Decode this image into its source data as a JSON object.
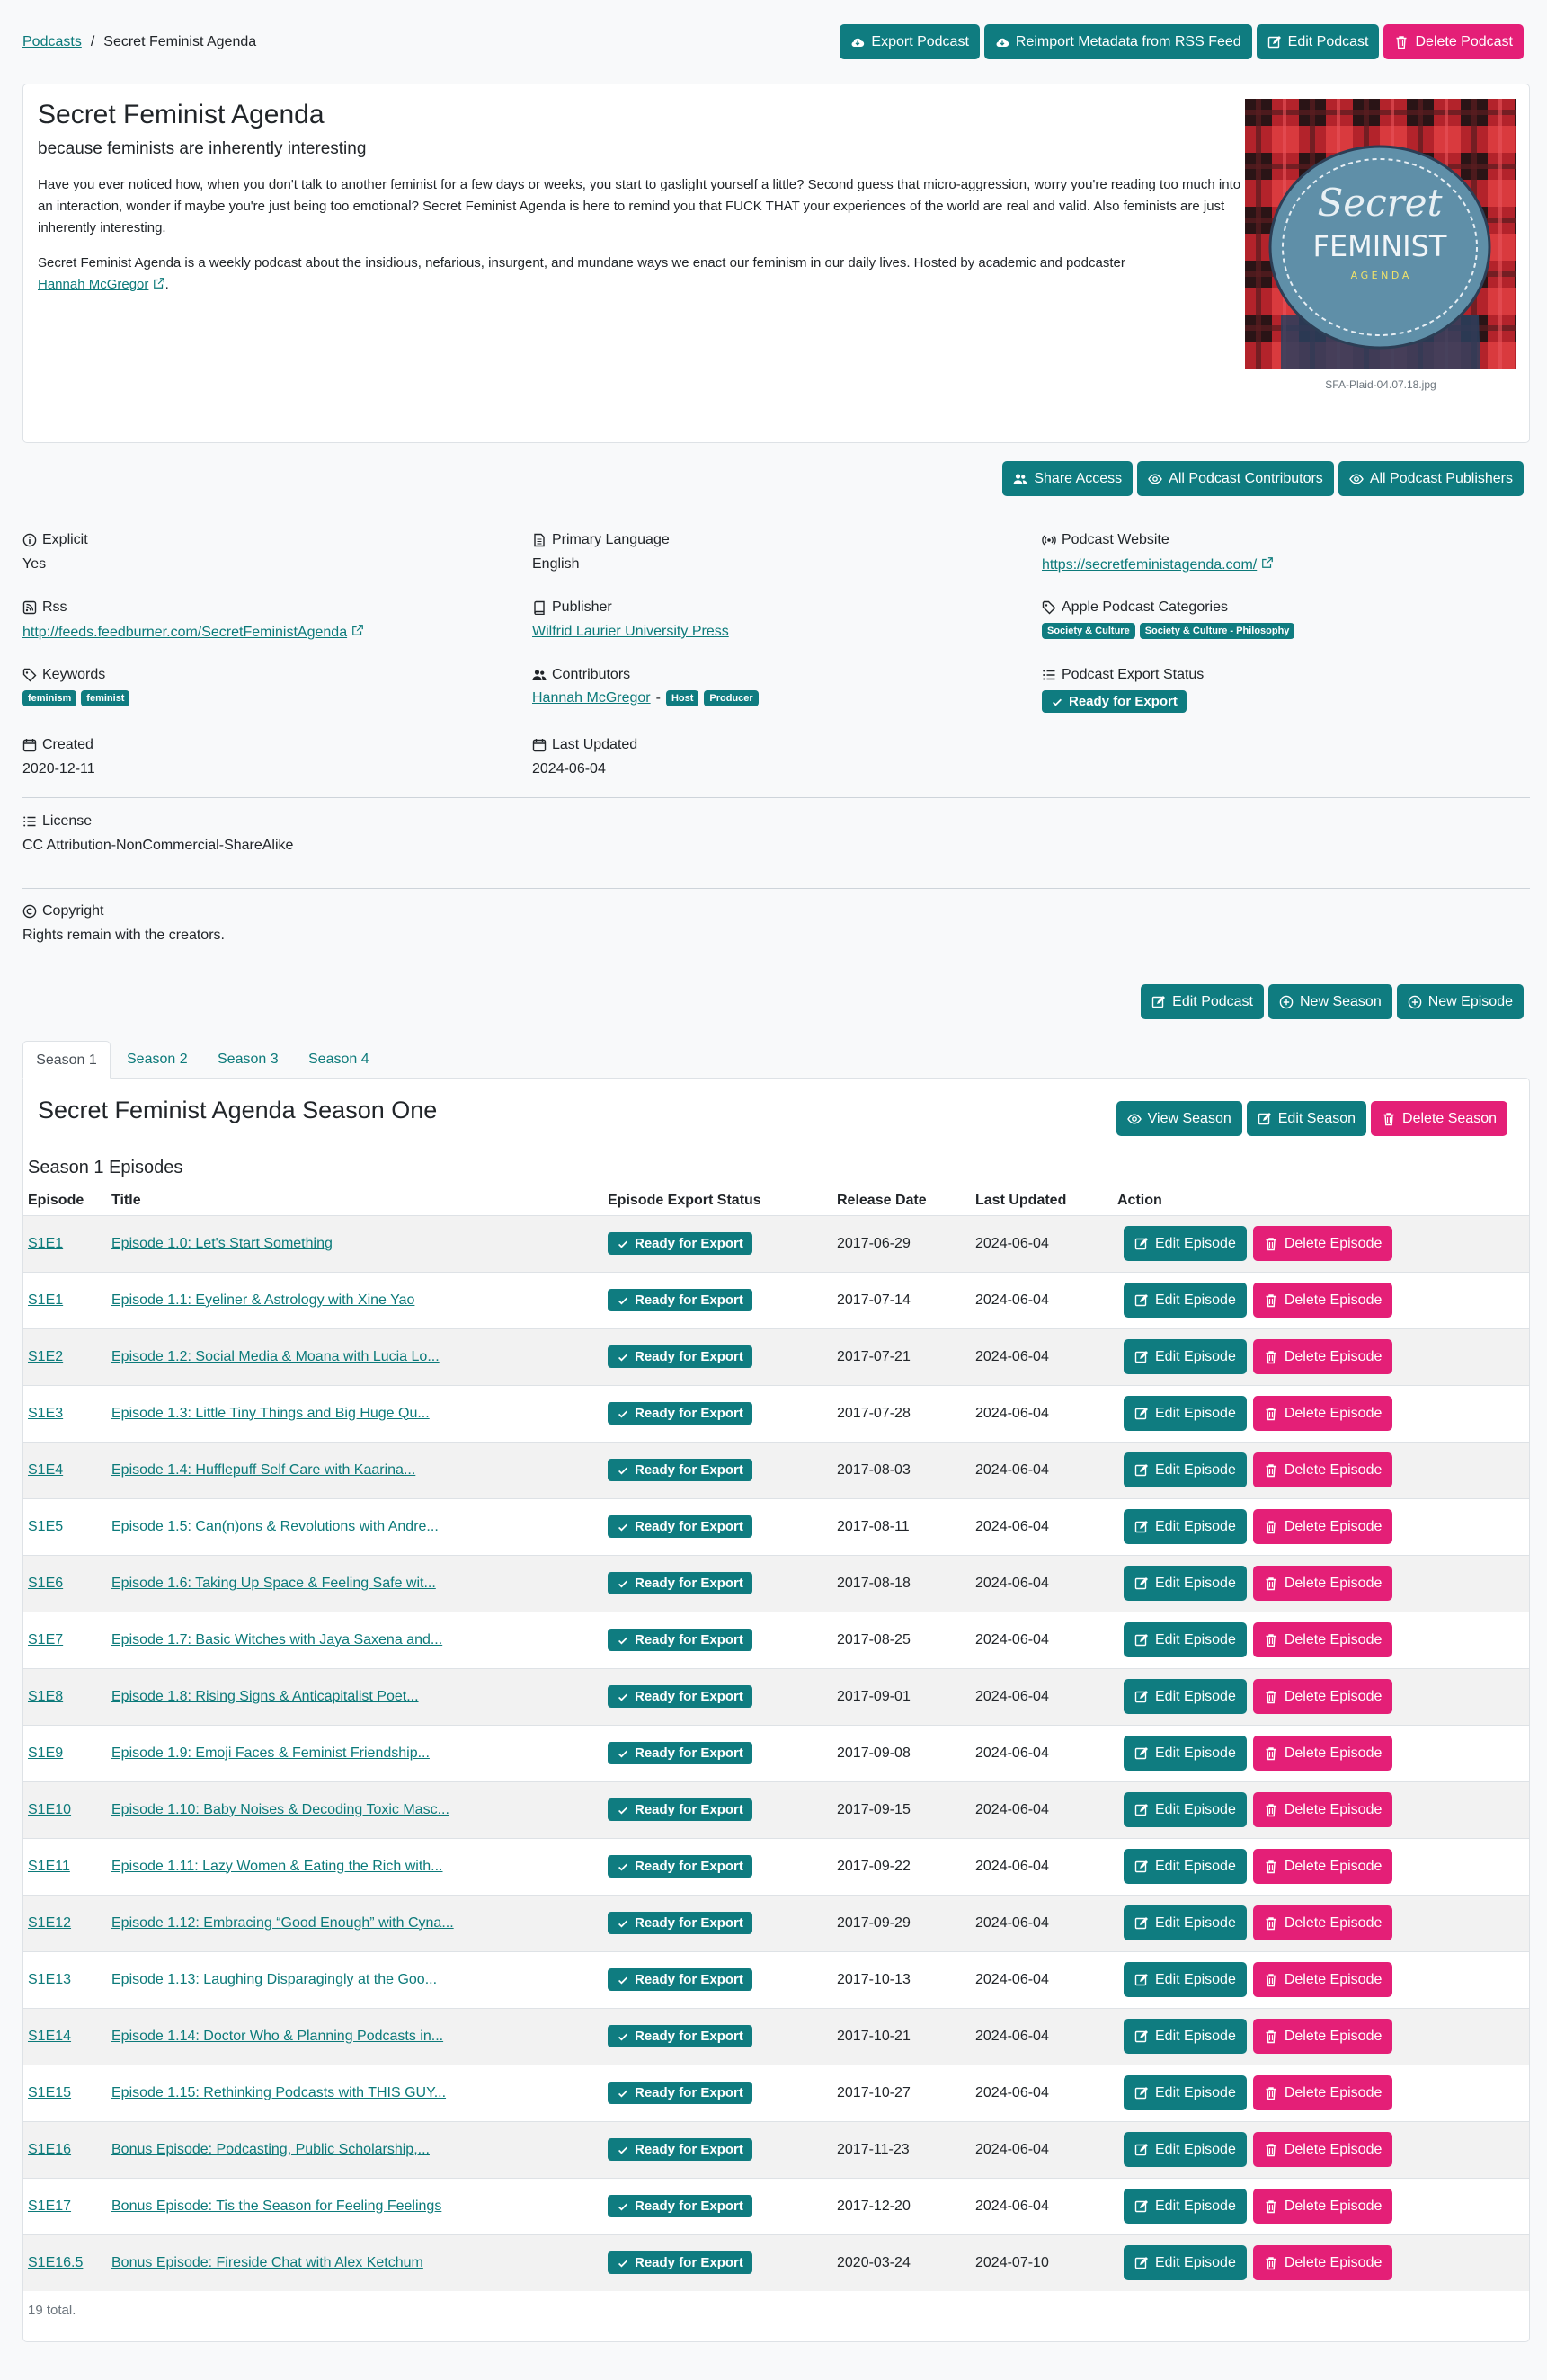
{
  "breadcrumb": {
    "root": "Podcasts",
    "separator": "/",
    "current": "Secret Feminist Agenda"
  },
  "top_actions": {
    "export": "Export Podcast",
    "reimport": "Reimport Metadata from RSS Feed",
    "edit": "Edit Podcast",
    "delete": "Delete Podcast"
  },
  "podcast": {
    "title": "Secret Feminist Agenda",
    "subtitle": "because feminists are inherently interesting",
    "desc1": "Have you ever noticed how, when you don't talk to another feminist for a few days or weeks, you start to gaslight yourself a little? Second guess that micro-aggression, worry you're reading too much into an interaction, wonder if maybe you're just being too emotional? Secret Feminist Agenda is here to remind you that FUCK THAT your experiences of the world are real and valid. Also feminists are just inherently interesting.",
    "desc2_prefix": "Secret Feminist Agenda is a weekly podcast about the insidious, nefarious, insurgent, and mundane ways we enact our feminism in our daily lives. Hosted by academic and podcaster",
    "desc2_link": "Hannah McGregor",
    "desc2_suffix": ".",
    "image_caption": "SFA-Plaid-04.07.18.jpg",
    "cover_script": "Secret",
    "cover_word": "FEMINIST",
    "cover_sub": "A G E N D A"
  },
  "access_actions": {
    "share": "Share Access",
    "contributors": "All Podcast Contributors",
    "publishers": "All Podcast Publishers"
  },
  "meta": {
    "explicit_label": "Explicit",
    "explicit_value": "Yes",
    "language_label": "Primary Language",
    "language_value": "English",
    "website_label": "Podcast Website",
    "website_value": "https://secretfeministagenda.com/",
    "rss_label": "Rss",
    "rss_value": "http://feeds.feedburner.com/SecretFeministAgenda",
    "publisher_label": "Publisher",
    "publisher_value": "Wilfrid Laurier University Press",
    "categories_label": "Apple Podcast Categories",
    "categories": [
      "Society & Culture",
      "Society & Culture - Philosophy"
    ],
    "keywords_label": "Keywords",
    "keywords": [
      "feminism",
      "feminist"
    ],
    "contributors_label": "Contributors",
    "contributor_name": "Hannah McGregor",
    "contributor_sep": "-",
    "contributor_roles": [
      "Host",
      "Producer"
    ],
    "export_status_label": "Podcast Export Status",
    "export_status_value": "Ready for Export",
    "created_label": "Created",
    "created_value": "2020-12-11",
    "updated_label": "Last Updated",
    "updated_value": "2024-06-04",
    "license_label": "License",
    "license_value": "CC Attribution-NonCommercial-ShareAlike",
    "copyright_label": "Copyright",
    "copyright_value": "Rights remain with the creators."
  },
  "mid_actions": {
    "edit": "Edit Podcast",
    "new_season": "New Season",
    "new_episode": "New Episode"
  },
  "tabs": [
    "Season 1",
    "Season 2",
    "Season 3",
    "Season 4"
  ],
  "season": {
    "title": "Secret Feminist Agenda Season One",
    "view": "View Season",
    "edit": "Edit Season",
    "delete": "Delete Season",
    "episodes_heading": "Season 1 Episodes",
    "columns": [
      "Episode",
      "Title",
      "Episode Export Status",
      "Release Date",
      "Last Updated",
      "Action"
    ],
    "edit_episode": "Edit Episode",
    "delete_episode": "Delete Episode",
    "total": "19 total."
  },
  "episodes": [
    {
      "ep": "S1E1",
      "title": "Episode 1.0: Let's Start Something",
      "status": "Ready for Export",
      "release": "2017-06-29",
      "updated": "2024-06-04"
    },
    {
      "ep": "S1E1",
      "title": "Episode 1.1: Eyeliner & Astrology with Xine Yao",
      "status": "Ready for Export",
      "release": "2017-07-14",
      "updated": "2024-06-04"
    },
    {
      "ep": "S1E2",
      "title": "Episode 1.2: Social Media & Moana with Lucia Lo...",
      "status": "Ready for Export",
      "release": "2017-07-21",
      "updated": "2024-06-04"
    },
    {
      "ep": "S1E3",
      "title": "Episode 1.3: Little Tiny Things and Big Huge Qu...",
      "status": "Ready for Export",
      "release": "2017-07-28",
      "updated": "2024-06-04"
    },
    {
      "ep": "S1E4",
      "title": "Episode 1.4: Hufflepuff Self Care with Kaarina...",
      "status": "Ready for Export",
      "release": "2017-08-03",
      "updated": "2024-06-04"
    },
    {
      "ep": "S1E5",
      "title": "Episode 1.5: Can(n)ons & Revolutions with Andre...",
      "status": "Ready for Export",
      "release": "2017-08-11",
      "updated": "2024-06-04"
    },
    {
      "ep": "S1E6",
      "title": "Episode 1.6: Taking Up Space & Feeling Safe wit...",
      "status": "Ready for Export",
      "release": "2017-08-18",
      "updated": "2024-06-04"
    },
    {
      "ep": "S1E7",
      "title": "Episode 1.7: Basic Witches with Jaya Saxena and...",
      "status": "Ready for Export",
      "release": "2017-08-25",
      "updated": "2024-06-04"
    },
    {
      "ep": "S1E8",
      "title": "Episode 1.8: Rising Signs & Anticapitalist Poet...",
      "status": "Ready for Export",
      "release": "2017-09-01",
      "updated": "2024-06-04"
    },
    {
      "ep": "S1E9",
      "title": "Episode 1.9: Emoji Faces & Feminist Friendship...",
      "status": "Ready for Export",
      "release": "2017-09-08",
      "updated": "2024-06-04"
    },
    {
      "ep": "S1E10",
      "title": "Episode 1.10: Baby Noises & Decoding Toxic Masc...",
      "status": "Ready for Export",
      "release": "2017-09-15",
      "updated": "2024-06-04"
    },
    {
      "ep": "S1E11",
      "title": "Episode 1.11: Lazy Women & Eating the Rich with...",
      "status": "Ready for Export",
      "release": "2017-09-22",
      "updated": "2024-06-04"
    },
    {
      "ep": "S1E12",
      "title": "Episode 1.12: Embracing “Good Enough” with Cyna...",
      "status": "Ready for Export",
      "release": "2017-09-29",
      "updated": "2024-06-04"
    },
    {
      "ep": "S1E13",
      "title": "Episode 1.13: Laughing Disparagingly at the Goo...",
      "status": "Ready for Export",
      "release": "2017-10-13",
      "updated": "2024-06-04"
    },
    {
      "ep": "S1E14",
      "title": "Episode 1.14: Doctor Who & Planning Podcasts in...",
      "status": "Ready for Export",
      "release": "2017-10-21",
      "updated": "2024-06-04"
    },
    {
      "ep": "S1E15",
      "title": "Episode 1.15: Rethinking Podcasts with THIS GUY...",
      "status": "Ready for Export",
      "release": "2017-10-27",
      "updated": "2024-06-04"
    },
    {
      "ep": "S1E16",
      "title": "Bonus Episode: Podcasting, Public Scholarship,...",
      "status": "Ready for Export",
      "release": "2017-11-23",
      "updated": "2024-06-04"
    },
    {
      "ep": "S1E17",
      "title": "Bonus Episode: Tis the Season for Feeling Feelings",
      "status": "Ready for Export",
      "release": "2017-12-20",
      "updated": "2024-06-04"
    },
    {
      "ep": "S1E16.5",
      "title": "Bonus Episode: Fireside Chat with Alex Ketchum",
      "status": "Ready for Export",
      "release": "2020-03-24",
      "updated": "2024-07-10"
    }
  ]
}
